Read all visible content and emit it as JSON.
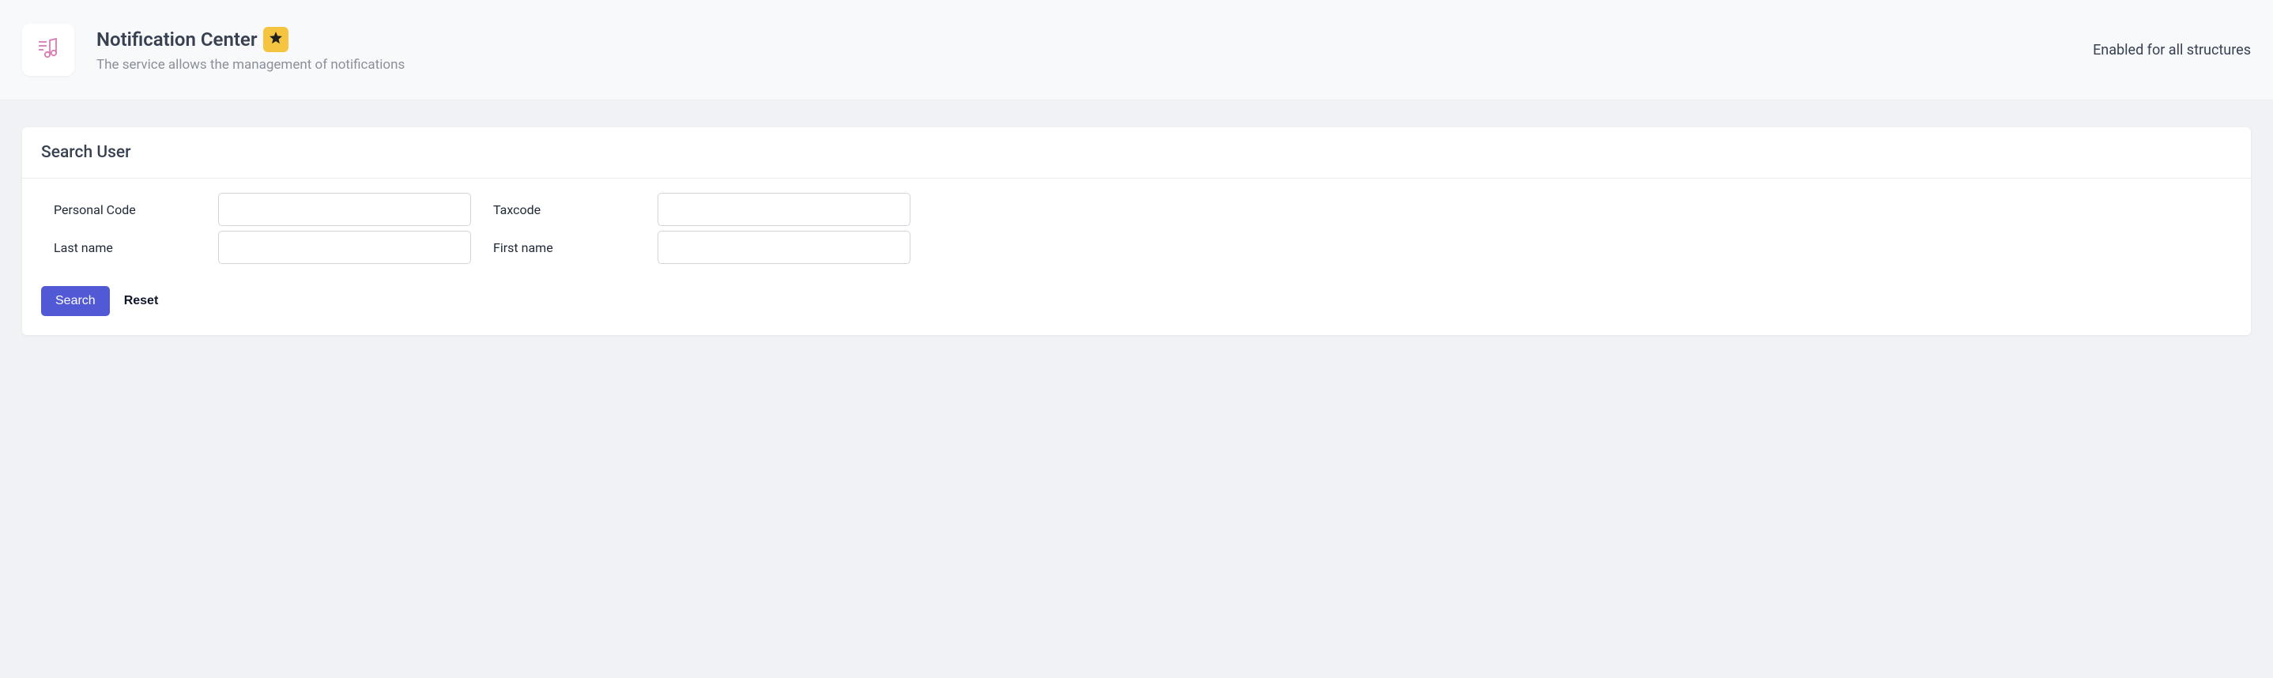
{
  "header": {
    "title": "Notification Center",
    "subtitle": "The service allows the management of notifications",
    "scope_label": "Enabled for all structures"
  },
  "card": {
    "title": "Search User",
    "fields": {
      "personal_code": {
        "label": "Personal Code",
        "value": ""
      },
      "taxcode": {
        "label": "Taxcode",
        "value": ""
      },
      "last_name": {
        "label": "Last name",
        "value": ""
      },
      "first_name": {
        "label": "First name",
        "value": ""
      }
    },
    "actions": {
      "search_label": "Search",
      "reset_label": "Reset"
    }
  }
}
